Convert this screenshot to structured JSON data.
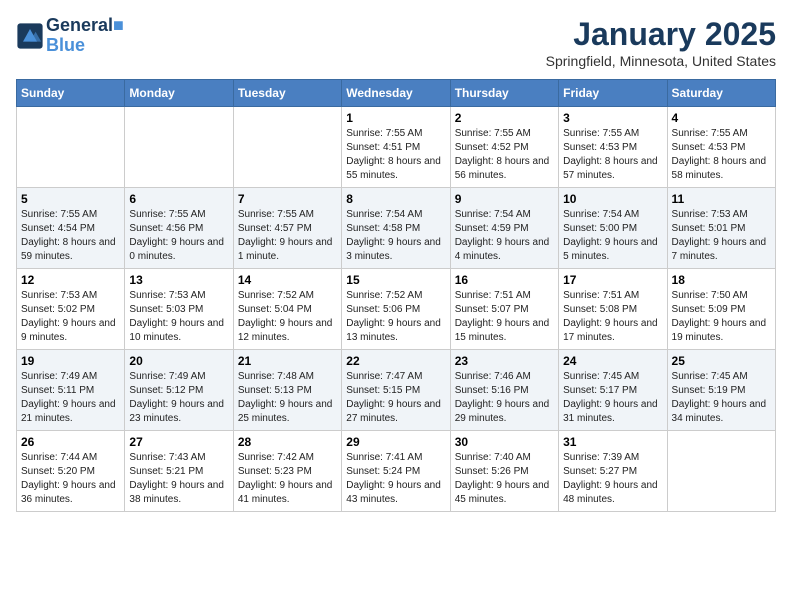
{
  "header": {
    "logo_line1": "General",
    "logo_line2": "Blue",
    "month": "January 2025",
    "location": "Springfield, Minnesota, United States"
  },
  "days_of_week": [
    "Sunday",
    "Monday",
    "Tuesday",
    "Wednesday",
    "Thursday",
    "Friday",
    "Saturday"
  ],
  "weeks": [
    [
      {
        "day": "",
        "empty": true
      },
      {
        "day": "",
        "empty": true
      },
      {
        "day": "",
        "empty": true
      },
      {
        "day": "1",
        "sunrise": "7:55 AM",
        "sunset": "4:51 PM",
        "daylight": "8 hours and 55 minutes."
      },
      {
        "day": "2",
        "sunrise": "7:55 AM",
        "sunset": "4:52 PM",
        "daylight": "8 hours and 56 minutes."
      },
      {
        "day": "3",
        "sunrise": "7:55 AM",
        "sunset": "4:53 PM",
        "daylight": "8 hours and 57 minutes."
      },
      {
        "day": "4",
        "sunrise": "7:55 AM",
        "sunset": "4:53 PM",
        "daylight": "8 hours and 58 minutes."
      }
    ],
    [
      {
        "day": "5",
        "sunrise": "7:55 AM",
        "sunset": "4:54 PM",
        "daylight": "8 hours and 59 minutes."
      },
      {
        "day": "6",
        "sunrise": "7:55 AM",
        "sunset": "4:56 PM",
        "daylight": "9 hours and 0 minutes."
      },
      {
        "day": "7",
        "sunrise": "7:55 AM",
        "sunset": "4:57 PM",
        "daylight": "9 hours and 1 minute."
      },
      {
        "day": "8",
        "sunrise": "7:54 AM",
        "sunset": "4:58 PM",
        "daylight": "9 hours and 3 minutes."
      },
      {
        "day": "9",
        "sunrise": "7:54 AM",
        "sunset": "4:59 PM",
        "daylight": "9 hours and 4 minutes."
      },
      {
        "day": "10",
        "sunrise": "7:54 AM",
        "sunset": "5:00 PM",
        "daylight": "9 hours and 5 minutes."
      },
      {
        "day": "11",
        "sunrise": "7:53 AM",
        "sunset": "5:01 PM",
        "daylight": "9 hours and 7 minutes."
      }
    ],
    [
      {
        "day": "12",
        "sunrise": "7:53 AM",
        "sunset": "5:02 PM",
        "daylight": "9 hours and 9 minutes."
      },
      {
        "day": "13",
        "sunrise": "7:53 AM",
        "sunset": "5:03 PM",
        "daylight": "9 hours and 10 minutes."
      },
      {
        "day": "14",
        "sunrise": "7:52 AM",
        "sunset": "5:04 PM",
        "daylight": "9 hours and 12 minutes."
      },
      {
        "day": "15",
        "sunrise": "7:52 AM",
        "sunset": "5:06 PM",
        "daylight": "9 hours and 13 minutes."
      },
      {
        "day": "16",
        "sunrise": "7:51 AM",
        "sunset": "5:07 PM",
        "daylight": "9 hours and 15 minutes."
      },
      {
        "day": "17",
        "sunrise": "7:51 AM",
        "sunset": "5:08 PM",
        "daylight": "9 hours and 17 minutes."
      },
      {
        "day": "18",
        "sunrise": "7:50 AM",
        "sunset": "5:09 PM",
        "daylight": "9 hours and 19 minutes."
      }
    ],
    [
      {
        "day": "19",
        "sunrise": "7:49 AM",
        "sunset": "5:11 PM",
        "daylight": "9 hours and 21 minutes."
      },
      {
        "day": "20",
        "sunrise": "7:49 AM",
        "sunset": "5:12 PM",
        "daylight": "9 hours and 23 minutes."
      },
      {
        "day": "21",
        "sunrise": "7:48 AM",
        "sunset": "5:13 PM",
        "daylight": "9 hours and 25 minutes."
      },
      {
        "day": "22",
        "sunrise": "7:47 AM",
        "sunset": "5:15 PM",
        "daylight": "9 hours and 27 minutes."
      },
      {
        "day": "23",
        "sunrise": "7:46 AM",
        "sunset": "5:16 PM",
        "daylight": "9 hours and 29 minutes."
      },
      {
        "day": "24",
        "sunrise": "7:45 AM",
        "sunset": "5:17 PM",
        "daylight": "9 hours and 31 minutes."
      },
      {
        "day": "25",
        "sunrise": "7:45 AM",
        "sunset": "5:19 PM",
        "daylight": "9 hours and 34 minutes."
      }
    ],
    [
      {
        "day": "26",
        "sunrise": "7:44 AM",
        "sunset": "5:20 PM",
        "daylight": "9 hours and 36 minutes."
      },
      {
        "day": "27",
        "sunrise": "7:43 AM",
        "sunset": "5:21 PM",
        "daylight": "9 hours and 38 minutes."
      },
      {
        "day": "28",
        "sunrise": "7:42 AM",
        "sunset": "5:23 PM",
        "daylight": "9 hours and 41 minutes."
      },
      {
        "day": "29",
        "sunrise": "7:41 AM",
        "sunset": "5:24 PM",
        "daylight": "9 hours and 43 minutes."
      },
      {
        "day": "30",
        "sunrise": "7:40 AM",
        "sunset": "5:26 PM",
        "daylight": "9 hours and 45 minutes."
      },
      {
        "day": "31",
        "sunrise": "7:39 AM",
        "sunset": "5:27 PM",
        "daylight": "9 hours and 48 minutes."
      },
      {
        "day": "",
        "empty": true
      }
    ]
  ]
}
